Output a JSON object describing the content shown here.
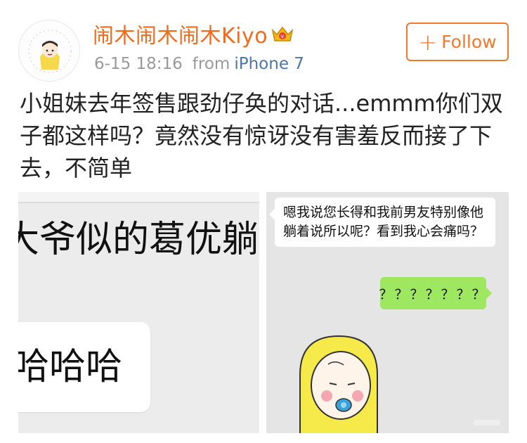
{
  "user": {
    "name": "闹木闹木闹木Kiyo",
    "badge_icon": "crown-icon",
    "badge_color": "#e8a317"
  },
  "meta": {
    "time": "6-15 18:16",
    "from_label": "from",
    "device": "iPhone 7"
  },
  "follow": {
    "label": "Follow",
    "color": "#f07a2a"
  },
  "post": {
    "text": "小姐妹去年签售跟劲仔奂的对话...emmm你们双子都这样吗？竟然没有惊讶没有害羞反而接了下去，不简单"
  },
  "image_left": {
    "headline": "大爷似的葛优躺",
    "bubble": "哈哈哈"
  },
  "image_right": {
    "message_in": "嗯我说您长得和我前男友特别像他躺着说所以呢？看到我心会痛吗？",
    "message_out": "？？？？？？？",
    "bubble_out_color": "#9ee760"
  }
}
